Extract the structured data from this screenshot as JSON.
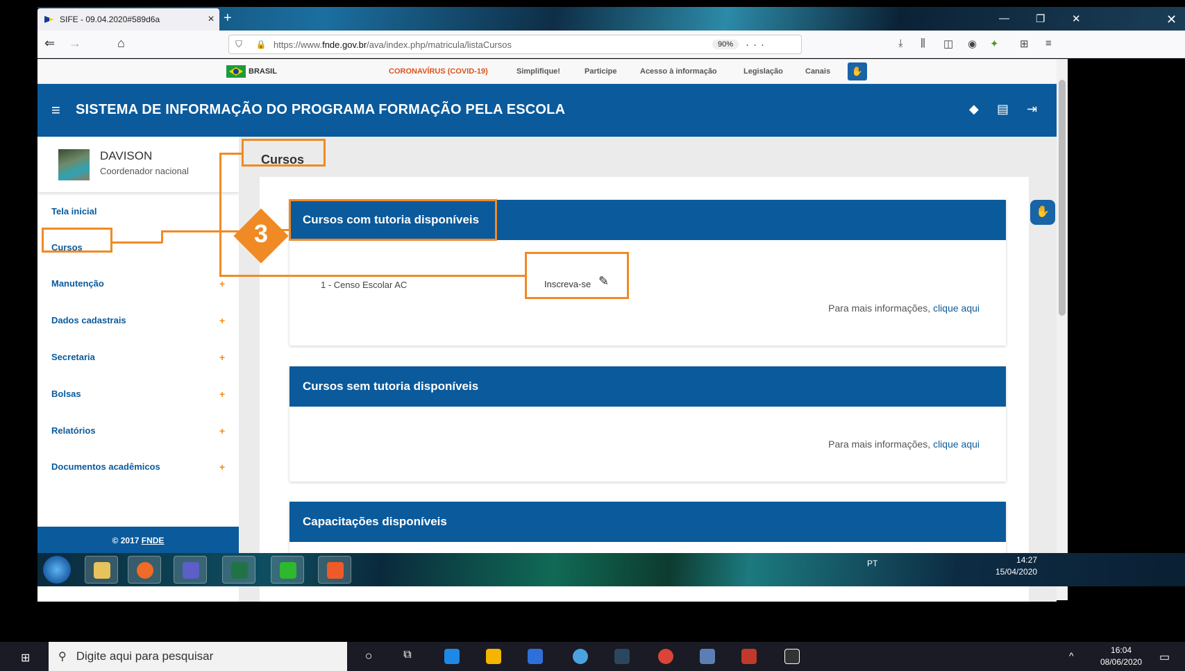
{
  "browser": {
    "tab_title": "SIFE - 09.04.2020#589d6a",
    "tab_close": "×",
    "new_tab": "+",
    "url_prefix": "https://www.",
    "url_domain": "fnde.gov.br",
    "url_path": "/ava/index.php/matricula/listaCursos",
    "zoom": "90%",
    "more": "···"
  },
  "govbar": {
    "brasil": "BRASIL",
    "links": [
      "CORONAVÍRUS (COVID-19)",
      "Simplifique!",
      "Participe",
      "Acesso à informação",
      "Legislação",
      "Canais"
    ]
  },
  "header": {
    "title": "SISTEMA DE INFORMAÇÃO DO PROGRAMA FORMAÇÃO PELA ESCOLA"
  },
  "user": {
    "name": "DAVISON",
    "role": "Coordenador nacional"
  },
  "sidebar": {
    "items": [
      {
        "label": "Tela inicial",
        "expandable": false
      },
      {
        "label": "Cursos",
        "expandable": false
      },
      {
        "label": "Manutenção",
        "expandable": true
      },
      {
        "label": "Dados cadastrais",
        "expandable": true
      },
      {
        "label": "Secretaria",
        "expandable": true
      },
      {
        "label": "Bolsas",
        "expandable": true
      },
      {
        "label": "Relatórios",
        "expandable": true
      },
      {
        "label": "Documentos acadêmicos",
        "expandable": true
      }
    ],
    "plus": "+",
    "footer_prefix": "© 2017 ",
    "footer_brand": "FNDE"
  },
  "main": {
    "breadcrumb": "Cursos",
    "panels": [
      {
        "title": "Cursos com tutoria disponíveis"
      },
      {
        "title": "Cursos sem tutoria disponíveis"
      },
      {
        "title": "Capacitações disponíveis"
      }
    ],
    "course": {
      "name": "1 - Censo Escolar AC",
      "action": "Inscreva-se"
    },
    "info_text": "Para mais informações, ",
    "info_link": "clique aqui"
  },
  "callout": {
    "number": "3",
    "color": "#f08a24"
  },
  "taskbar_inner": {
    "lang": "PT",
    "time": "14:27",
    "date": "15/04/2020"
  },
  "taskbar_outer": {
    "search_placeholder": "Digite aqui para pesquisar",
    "time": "16:04",
    "date": "08/06/2020"
  },
  "colors": {
    "brand_blue": "#0a5a9c",
    "accent_orange": "#f08a24"
  }
}
